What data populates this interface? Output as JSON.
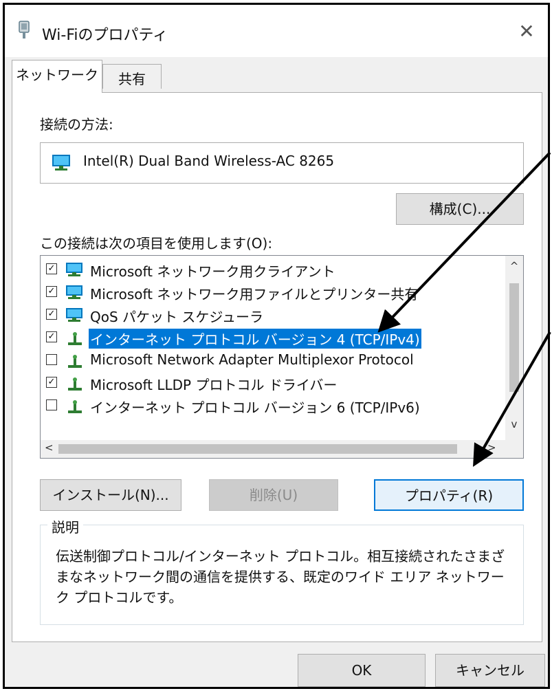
{
  "window": {
    "title": "Wi-Fiのプロパティ",
    "close_glyph": "✕"
  },
  "tabs": [
    {
      "label": "ネットワーク"
    },
    {
      "label": "共有"
    }
  ],
  "connection": {
    "label": "接続の方法:",
    "adapter": "Intel(R) Dual Band Wireless-AC 8265",
    "configure_button": "構成(C)..."
  },
  "items_section": {
    "label": "この接続は次の項目を使用します(O):",
    "items": [
      {
        "label": "Microsoft ネットワーク用クライアント",
        "checked": true,
        "icon": "network-client-icon"
      },
      {
        "label": "Microsoft ネットワーク用ファイルとプリンター共有",
        "checked": true,
        "icon": "network-client-icon"
      },
      {
        "label": "QoS パケット スケジューラ",
        "checked": true,
        "icon": "network-client-icon"
      },
      {
        "label": "インターネット プロトコル バージョン 4 (TCP/IPv4)",
        "checked": true,
        "icon": "protocol-icon",
        "selected": true
      },
      {
        "label": "Microsoft Network Adapter Multiplexor Protocol",
        "checked": false,
        "icon": "protocol-icon"
      },
      {
        "label": "Microsoft LLDP プロトコル ドライバー",
        "checked": true,
        "icon": "protocol-icon"
      },
      {
        "label": "インターネット プロトコル バージョン 6 (TCP/IPv6)",
        "checked": false,
        "icon": "protocol-icon"
      }
    ]
  },
  "buttons": {
    "install": "インストール(N)...",
    "delete": "削除(U)",
    "properties": "プロパティ(R)",
    "ok": "OK",
    "cancel": "キャンセル"
  },
  "description": {
    "title": "説明",
    "text": "伝送制御プロトコル/インターネット プロトコル。相互接続されたさまざまなネットワーク間の通信を提供する、既定のワイド エリア ネットワーク プロトコルです。"
  },
  "colors": {
    "selection": "#0078d7",
    "accent_border": "#0078d7",
    "window_bg": "#f0f0f0"
  }
}
